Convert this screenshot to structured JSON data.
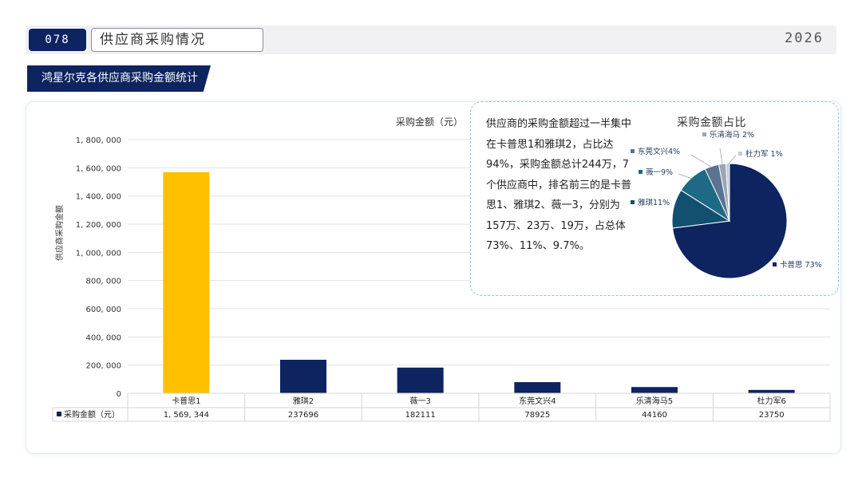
{
  "header": {
    "page_number": "078",
    "title": "供应商采购情况",
    "year": "2026"
  },
  "section": {
    "title": "鸿星尔克各供应商采购金额统计"
  },
  "summary_text": "供应商的采购金额超过一半集中在卡普思1和雅琪2，占比达94%，采购金额总计244万，7个供应商中，排名前三的是卡普思1、雅琪2、薇一3，分别为157万、23万、19万，占总体73%、11%、9.7%。",
  "colors": {
    "primary": "#0d2460",
    "highlight": "#ffc000",
    "pie_palette": [
      "#0d2460",
      "#134f6e",
      "#1e6a85",
      "#5a7390",
      "#9aa6b4",
      "#c4cad4"
    ]
  },
  "chart_data": [
    {
      "type": "bar",
      "title": "采购金额（元）",
      "ylabel": "供应商采购金额",
      "xlabel": "",
      "categories": [
        "卡普思1",
        "雅琪2",
        "薇一3",
        "东莞文兴4",
        "乐清海马5",
        "杜力军6"
      ],
      "series": [
        {
          "name": "采购金额（元）",
          "values": [
            1569344,
            237696,
            182111,
            78925,
            44160,
            23750
          ],
          "value_labels": [
            "1, 569, 344",
            "237696",
            "182111",
            "78925",
            "44160",
            "23750"
          ]
        }
      ],
      "highlight_index": 0,
      "ylim": [
        0,
        1800000
      ],
      "yticks": [
        0,
        200000,
        400000,
        600000,
        800000,
        1000000,
        1200000,
        1400000,
        1600000,
        1800000
      ],
      "ytick_labels": [
        "0",
        "200, 000",
        "400, 000",
        "600, 000",
        "800, 000",
        "1, 000, 000",
        "1, 200, 000",
        "1, 400, 000",
        "1, 600, 000",
        "1, 800, 000"
      ],
      "grid": true,
      "data_table": true
    },
    {
      "type": "pie",
      "title": "采购金额占比",
      "labels": [
        "卡普思",
        "雅琪",
        "薇一",
        "东莞文兴",
        "乐清海马",
        "杜力军"
      ],
      "values": [
        73,
        11,
        9,
        4,
        2,
        1
      ],
      "label_texts": [
        "卡普思 73%",
        "雅琪11%",
        "薇一9%",
        "东莞文兴4%",
        "乐清海马 2%",
        "杜力军 1%"
      ]
    }
  ]
}
